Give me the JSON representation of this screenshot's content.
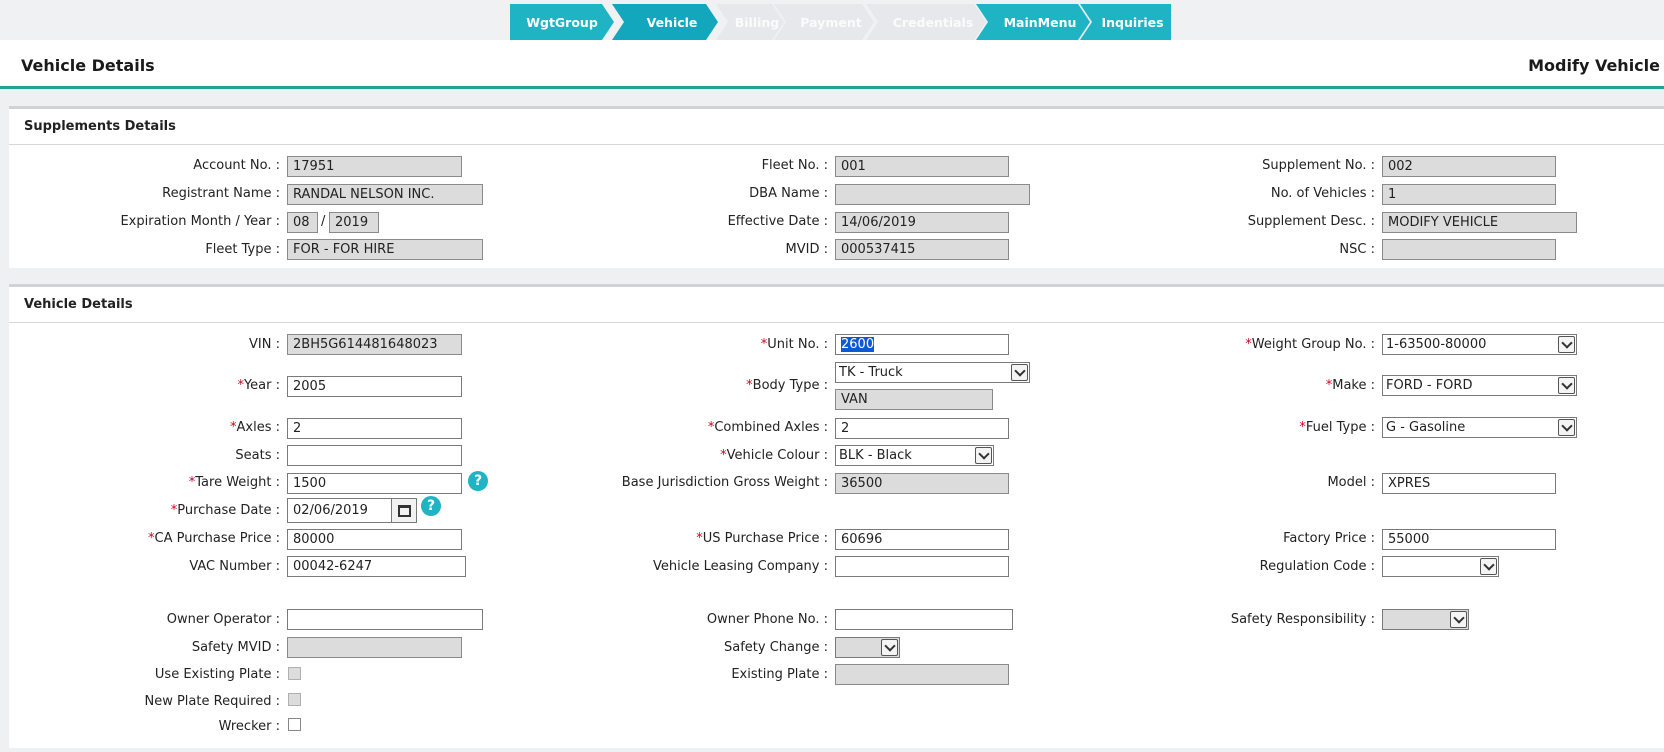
{
  "wizard": {
    "steps": [
      {
        "label": "WgtGroup",
        "state": "active"
      },
      {
        "label": "Vehicle",
        "state": "current"
      },
      {
        "label": "Billing",
        "state": "disabled"
      },
      {
        "label": "Payment",
        "state": "disabled"
      },
      {
        "label": "Credentials",
        "state": "disabled"
      },
      {
        "label": "MainMenu",
        "state": "active"
      },
      {
        "label": "Inquiries",
        "state": "active"
      }
    ]
  },
  "header": {
    "title": "Vehicle Details",
    "mode": "Modify Vehicle"
  },
  "supplements": {
    "title": "Supplements Details",
    "account_no": {
      "label": "Account No. :",
      "value": "17951"
    },
    "registrant_name": {
      "label": "Registrant Name :",
      "value": "RANDAL NELSON INC."
    },
    "expiration": {
      "label": "Expiration Month / Year :",
      "month": "08",
      "sep": "/",
      "year": "2019"
    },
    "fleet_type": {
      "label": "Fleet Type :",
      "value": "FOR - FOR HIRE"
    },
    "fleet_no": {
      "label": "Fleet No. :",
      "value": "001"
    },
    "dba_name": {
      "label": "DBA Name :",
      "value": ""
    },
    "effective_date": {
      "label": "Effective Date :",
      "value": "14/06/2019"
    },
    "mvid": {
      "label": "MVID :",
      "value": "000537415"
    },
    "supplement_no": {
      "label": "Supplement No. :",
      "value": "002"
    },
    "no_of_vehicles": {
      "label": "No. of Vehicles :",
      "value": "1"
    },
    "supplement_desc": {
      "label": "Supplement Desc. :",
      "value": "MODIFY VEHICLE"
    },
    "nsc": {
      "label": "NSC :",
      "value": ""
    }
  },
  "vehicle": {
    "title": "Vehicle Details",
    "required_mark": "*",
    "vin": {
      "label": "VIN :",
      "value": "2BH5G614481648023"
    },
    "year": {
      "label": "Year :",
      "value": "2005"
    },
    "axles": {
      "label": "Axles :",
      "value": "2"
    },
    "seats": {
      "label": "Seats :",
      "value": ""
    },
    "tare_weight": {
      "label": "Tare Weight :",
      "value": "1500"
    },
    "purchase_date": {
      "label": "Purchase Date :",
      "value": "02/06/2019"
    },
    "ca_purchase_price": {
      "label": "CA Purchase Price :",
      "value": "80000"
    },
    "vac_number": {
      "label": "VAC Number :",
      "value": "00042-6247"
    },
    "owner_operator": {
      "label": "Owner Operator :",
      "value": ""
    },
    "safety_mvid": {
      "label": "Safety MVID :",
      "value": ""
    },
    "use_existing_plate": {
      "label": "Use Existing Plate :"
    },
    "new_plate_required": {
      "label": "New Plate Required :"
    },
    "wrecker": {
      "label": "Wrecker :"
    },
    "unit_no": {
      "label": "Unit No. :",
      "value": "2600"
    },
    "body_type": {
      "label": "Body Type :",
      "value": "TK - Truck",
      "sub_value": "VAN"
    },
    "combined_axles": {
      "label": "Combined Axles :",
      "value": "2"
    },
    "vehicle_colour": {
      "label": "Vehicle Colour :",
      "value": "BLK - Black"
    },
    "base_jurisdiction_gross_weight": {
      "label": "Base Jurisdiction Gross Weight :",
      "value": "36500"
    },
    "us_purchase_price": {
      "label": "US Purchase Price :",
      "value": "60696"
    },
    "vehicle_leasing_company": {
      "label": "Vehicle Leasing Company :",
      "value": ""
    },
    "owner_phone_no": {
      "label": "Owner Phone No. :",
      "value": ""
    },
    "safety_change": {
      "label": "Safety Change :",
      "value": ""
    },
    "existing_plate": {
      "label": "Existing Plate :",
      "value": ""
    },
    "weight_group_no": {
      "label": "Weight Group No. :",
      "value": "1-63500-80000"
    },
    "make": {
      "label": "Make :",
      "value": "FORD - FORD"
    },
    "fuel_type": {
      "label": "Fuel Type :",
      "value": "G - Gasoline"
    },
    "model": {
      "label": "Model :",
      "value": "XPRES"
    },
    "factory_price": {
      "label": "Factory Price :",
      "value": "55000"
    },
    "regulation_code": {
      "label": "Regulation Code :",
      "value": ""
    },
    "safety_responsibility": {
      "label": "Safety Responsibility :",
      "value": ""
    }
  },
  "help_icon_glyph": "?",
  "colors": {
    "accent": "#1fb4c4",
    "header_rule": "#1fa39a",
    "required": "#d0021b",
    "readonly_bg": "#dcdcdc"
  }
}
